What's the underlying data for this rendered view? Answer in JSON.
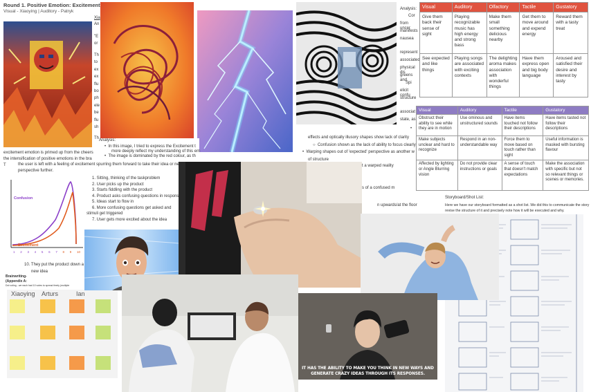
{
  "document": {
    "title": "Round 1. Positive Emotion: Excitement",
    "subtitle": "Visual - Xiaoying | Auditory - Patryk",
    "author_frag": "Xia",
    "author_frag2": "An",
    "quote_frags": [
      "\"E",
      "or"
    ],
    "para_frags": [
      "Th",
      "to",
      "ex",
      "ex",
      "flu",
      "bo",
      "ph",
      "ele",
      "be",
      "flu",
      "sh"
    ],
    "para_end_frag": "Th",
    "excitement_line": "excitement emotion is primed up from the cheers",
    "intensify_line": "the intensification of positive emotions in the bra",
    "t_frag": "T",
    "user_left_line": "the user is left with a feeling of excitement spurring them forward to take their idea or ne",
    "perspective_line": "perspective further.",
    "analysis_label": "Analysis:",
    "analysis_bullets": [
      "In this image, I tried to express the Excitement t",
      "more deeply reflect my understanding of this em",
      "The image is dominated by the red colour, as th"
    ]
  },
  "middle_doc": {
    "analysis_label": "Analysis:",
    "frags": [
      "Cor",
      "from uncer",
      "manifests",
      "nausea",
      "represent",
      "associated",
      "physical dis",
      "greens and",
      "Spi",
      "elicit confu",
      "structure",
      "associat",
      "state, as"
    ],
    "line_effects": "effects  and optically illusory shapes show lack of clarity",
    "line_confusion": "Confusion shown as the lack of ability to focus clearly",
    "line_warping": "Warping shapes out of 'expected' perspective as another w",
    "line_structure": "of structure",
    "frag_warped": "t a warped reality",
    "frag_confused": "s of a confused m",
    "frag_floor": "n upwards/at the floor"
  },
  "table_senses": {
    "headers": [
      "Visual",
      "Auditory",
      "Olfactory",
      "Tactile",
      "Gustatory"
    ],
    "rows": [
      [
        "Give them back their sense of sight",
        "Playing recognizable music has high energy and strong bass",
        "Make them small something delicious nearby",
        "Get them to move around and expend energy",
        "Reward them with a tasty treat"
      ],
      [
        "See expected and like things",
        "Playing songs are associated with exciting contexts",
        "The delighting aroma makes association with wonderful things",
        "Have them express open and big body language",
        "Aroused and satisfied their desire and interest by tasty"
      ]
    ]
  },
  "table_confusion": {
    "headers": [
      "Visual",
      "Auditory",
      "Tactile",
      "Gustatory"
    ],
    "rows": [
      [
        "Obstruct their ability to see while they are in motion",
        "Use ominous and unstructured sounds",
        "Have items touched not follow their descriptions",
        "Have items tasted not follow their descriptions"
      ],
      [
        "Make subjects unclear and hard to recognize",
        "Respond in an non-understandable way",
        "Force them to move based on touch rather than sight",
        "Useful information is masked with bursting flavour"
      ],
      [
        "Affected by lighting or Angle Blurring vision",
        "Do not provide clear instructions or goals",
        "A sense of touch that doesn't match expectations",
        "Make the association with specific but not so relevant things or scenes or memories."
      ]
    ]
  },
  "chart_data": {
    "type": "line",
    "series": [
      {
        "name": "Confusion",
        "color": "#8b3fc9"
      },
      {
        "name": "Excitement",
        "color": "#e05a1c"
      }
    ],
    "x_ticks": [
      "1",
      "2",
      "3",
      "4",
      "5",
      "6",
      "7",
      "8",
      "9",
      "10"
    ],
    "x_tick_colors": [
      "#8b3fc9",
      "#8b3fc9",
      "#8b3fc9",
      "#8b3fc9",
      "#8b3fc9",
      "#8b3fc9",
      "#8b3fc9",
      "#e05a1c",
      "#e05a1c",
      "#e05a1c"
    ]
  },
  "steps": [
    "1.  Sitting, thinking of the taskproblem",
    "2.  User picks up the product",
    "3.  Starts fiddling with the product",
    "4.  Product asks confusing questions in respons",
    "5.  Ideas start to flow in",
    "6.  More confusing questions get asked and",
    "stimuli get triggered",
    "7.  User gets more excited about the idea"
  ],
  "step10": "10. They put the product down a",
  "step10b": "new idea",
  "brainwriting": {
    "title": "Brainwriting-",
    "appendix": "(Appendix A:",
    "note": "Dot voting - we each had 10 votes to spread freely (multiple",
    "names": [
      "Xiaoying",
      "Arturs",
      "Ian"
    ]
  },
  "storyboard": {
    "title": "Storyboard/Shot List:",
    "line1": "Here we have our storyboard formatted as a shot list. We did this to communicate the story",
    "line2": "revise the structure of it and precisely note how it will be executed and why."
  },
  "video_caption": {
    "line1": "IT HAS THE ABILITY TO MAKE YOU THINK IN NEW WAYS AND",
    "line2": "GENERATE CRAZY IDEAS THROUGH ITS RESPONSES."
  },
  "colors": {
    "red_header": "#e0533f",
    "purple_header": "#8e7cc3"
  }
}
